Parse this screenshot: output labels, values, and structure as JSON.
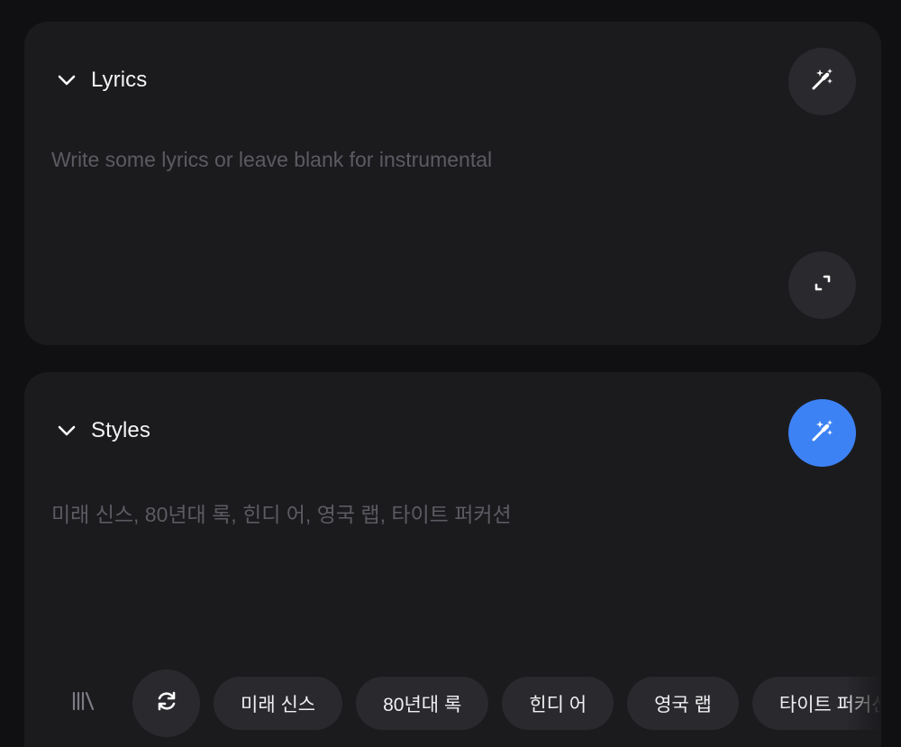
{
  "lyrics": {
    "title": "Lyrics",
    "placeholder": "Write some lyrics or leave blank for instrumental"
  },
  "styles": {
    "title": "Styles",
    "placeholder": "미래 신스, 80년대 록, 힌디 어, 영국 랩, 타이트 퍼커션",
    "chips": [
      "미래 신스",
      "80년대 록",
      "힌디 어",
      "영국 랩",
      "타이트 퍼커션"
    ]
  },
  "colors": {
    "background": "#101012",
    "card": "#1b1b1e",
    "button": "#2a2a2e",
    "accent": "#3d82f5",
    "placeholder": "#5b5b62"
  },
  "icons": {
    "collapse": "chevron-down-icon",
    "magic": "magic-wand-icon",
    "expand": "expand-icon",
    "library": "library-icon",
    "refresh": "refresh-icon"
  }
}
